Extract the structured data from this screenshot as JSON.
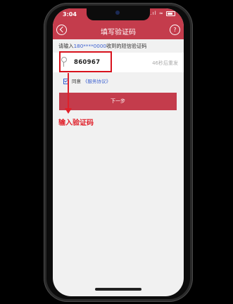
{
  "status_bar": {
    "time": "3:04",
    "signal": "..ıl",
    "wifi": "≈"
  },
  "nav": {
    "title": "填写验证码",
    "help_symbol": "?"
  },
  "instruction": {
    "prefix": "请输入",
    "phone": "180****0000",
    "suffix": "收到的短信验证码"
  },
  "code_field": {
    "value": "860967",
    "countdown": "46秒后重发"
  },
  "agreement": {
    "label": "同意",
    "link": "《服务协议》",
    "checked": true
  },
  "next_button": {
    "label": "下一步"
  },
  "annotation": {
    "text": "输入验证码",
    "color": "#e0202a"
  },
  "colors": {
    "brand": "#c43c4c",
    "link": "#3a5fd0",
    "highlight": "#d8121d"
  }
}
